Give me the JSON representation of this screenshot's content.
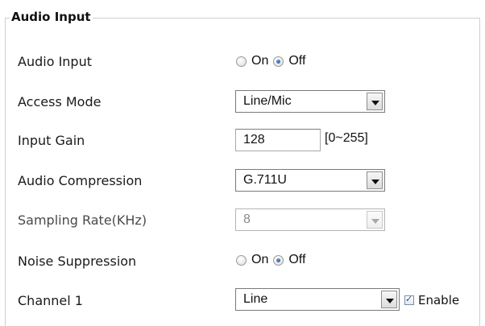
{
  "panel": {
    "title": "Audio Input"
  },
  "rows": {
    "audio_input": {
      "label": "Audio Input",
      "on_label": "On",
      "off_label": "Off",
      "selected": "Off"
    },
    "access_mode": {
      "label": "Access Mode",
      "value": "Line/Mic"
    },
    "input_gain": {
      "label": "Input Gain",
      "value": "128",
      "range": "[0~255]"
    },
    "audio_compression": {
      "label": "Audio Compression",
      "value": "G.711U"
    },
    "sampling_rate": {
      "label": "Sampling Rate(KHz)",
      "value": "8",
      "disabled": true
    },
    "noise_suppression": {
      "label": "Noise Suppression",
      "on_label": "On",
      "off_label": "Off",
      "selected": "Off"
    },
    "channel_1": {
      "label": "Channel 1",
      "value": "Line",
      "enable_label": "Enable",
      "enable_checked": true
    }
  },
  "colors": {
    "radio_selected": "#1d4f95",
    "border": "#cfcfcf"
  },
  "icons": {
    "dropdown": "chevron-down-icon",
    "checkbox": "checkmark-icon"
  }
}
